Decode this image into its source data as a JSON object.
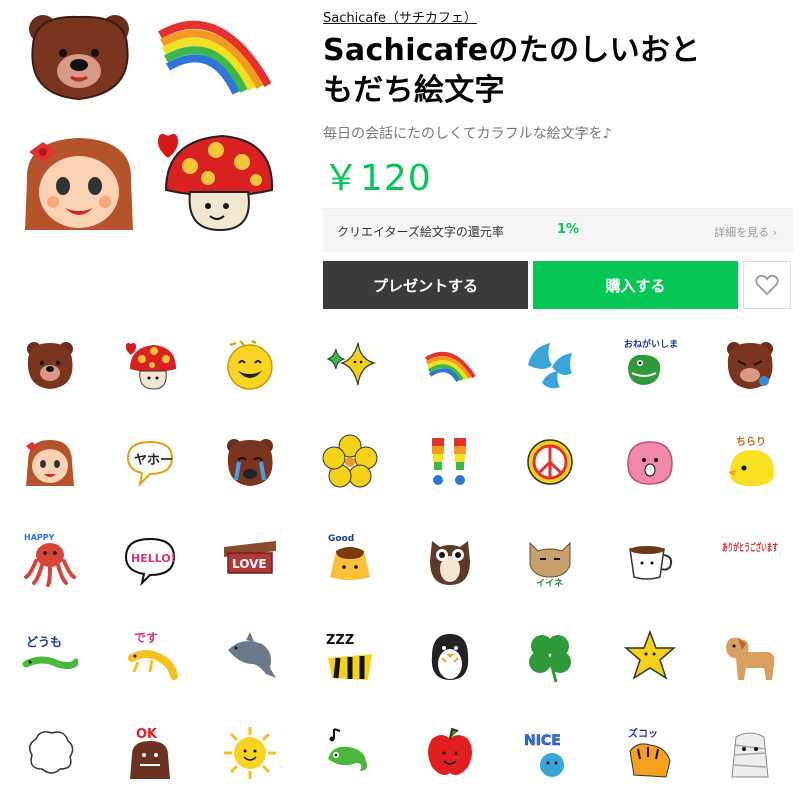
{
  "product": {
    "author": "Sachicafe（サチカフェ）",
    "title_line1": "Sachicafeのたのしいおと",
    "title_line2": "もだち絵文字",
    "description": "毎日の会話にたのしくてカラフルな絵文字を♪",
    "price": "￥120"
  },
  "royalty": {
    "label": "クリエイターズ絵文字の還元率",
    "value": "1%",
    "more_link": "詳細を見る ›"
  },
  "actions": {
    "gift_label": "プレゼントする",
    "buy_label": "購入する",
    "favorite_icon": "heart-outline-icon"
  },
  "hero_emoji": [
    "bear-face",
    "rainbow",
    "girl-face",
    "mushroom"
  ],
  "emoji_grid": {
    "rows": [
      [
        "bear-face",
        "mushroom",
        "smiley-sun",
        "sparkle-stars",
        "rainbow",
        "water-drops",
        "dinosaur-onegaishimasu",
        "bear-grumpy"
      ],
      [
        "girl-face",
        "yaho-speech",
        "bear-crying",
        "yellow-flower",
        "rainbow-exclamation",
        "peace-sign",
        "pink-blob",
        "chick-chirari"
      ],
      [
        "octopus-happy",
        "hello-speech",
        "love-sign",
        "pudding-good",
        "owl",
        "cat-iine",
        "coffee-cup",
        "arigatou-text"
      ],
      [
        "lizard-doumo",
        "lizard-desu",
        "dolphin",
        "bee-zzz",
        "penguin",
        "clover",
        "star",
        "dog"
      ],
      [
        "puff-cloud",
        "ok-monster",
        "sun-smile",
        "chameleon-music",
        "apple-smile",
        "nice-blue",
        "tiger-zuko",
        "mummy"
      ]
    ],
    "texts": {
      "onegai": "おねがいします",
      "yaho": "ヤホー",
      "chirari": "ちらり",
      "happy": "HAPPY",
      "hello": "HELLO!",
      "love": "LOVE",
      "good": "Good",
      "iine": "イイネ",
      "arigatou": "ありがとうございます",
      "doumo": "どうも",
      "desu": "です",
      "zzz": "ZZZ",
      "ok": "OK",
      "nice": "NICE",
      "zuko": "ズコッ"
    }
  },
  "colors": {
    "accent_green": "#06c755",
    "gift_button": "#3b3b3b",
    "description_gray": "#777777"
  }
}
